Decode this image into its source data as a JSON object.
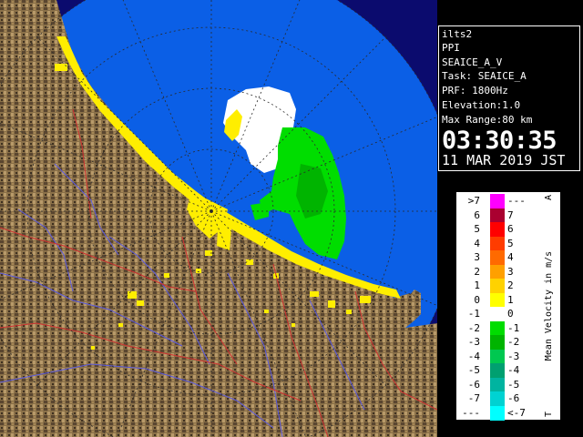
{
  "info": {
    "station": "ilts2",
    "product": "PPI",
    "variable": "SEAICE_A_V",
    "task": "Task: SEAICE_A",
    "prf": "PRF: 1800Hz",
    "elevation": "Elevation:1.0",
    "max_range": "Max Range:80 km",
    "time": "03:30:35",
    "date": "11 MAR 2019 JST"
  },
  "legend": {
    "title": "Mean Velocity in m/s",
    "top_mark": "A",
    "bottom_mark": "T",
    "rows": [
      {
        "left": ">7",
        "right": "---",
        "color": "#ff00ff"
      },
      {
        "left": "6",
        "right": "7",
        "color": "#aa0030"
      },
      {
        "left": "5",
        "right": "6",
        "color": "#ff0000"
      },
      {
        "left": "4",
        "right": "5",
        "color": "#ff3c00"
      },
      {
        "left": "3",
        "right": "4",
        "color": "#ff6a00"
      },
      {
        "left": "2",
        "right": "3",
        "color": "#ffa000"
      },
      {
        "left": "1",
        "right": "2",
        "color": "#ffd200"
      },
      {
        "left": "0",
        "right": "1",
        "color": "#ffff00"
      },
      {
        "left": "-1",
        "right": "0",
        "color": "#ffffff"
      },
      {
        "left": "-2",
        "right": "-1",
        "color": "#00dd00"
      },
      {
        "left": "-3",
        "right": "-2",
        "color": "#00b400"
      },
      {
        "left": "-4",
        "right": "-3",
        "color": "#00c850"
      },
      {
        "left": "-5",
        "right": "-4",
        "color": "#00a070"
      },
      {
        "left": "-6",
        "right": "-5",
        "color": "#00b4a0"
      },
      {
        "left": "-7",
        "right": "-6",
        "color": "#00d2d2"
      },
      {
        "left": "---",
        "right": "<-7",
        "color": "#00ffff"
      }
    ]
  },
  "colors": {
    "sea": "#0b5fe6",
    "outside": "#0b0b6e",
    "land": "#8a7048",
    "coast_ice": "#ffee00",
    "rivers": "#5a5ae0",
    "borders": "#d03030"
  }
}
